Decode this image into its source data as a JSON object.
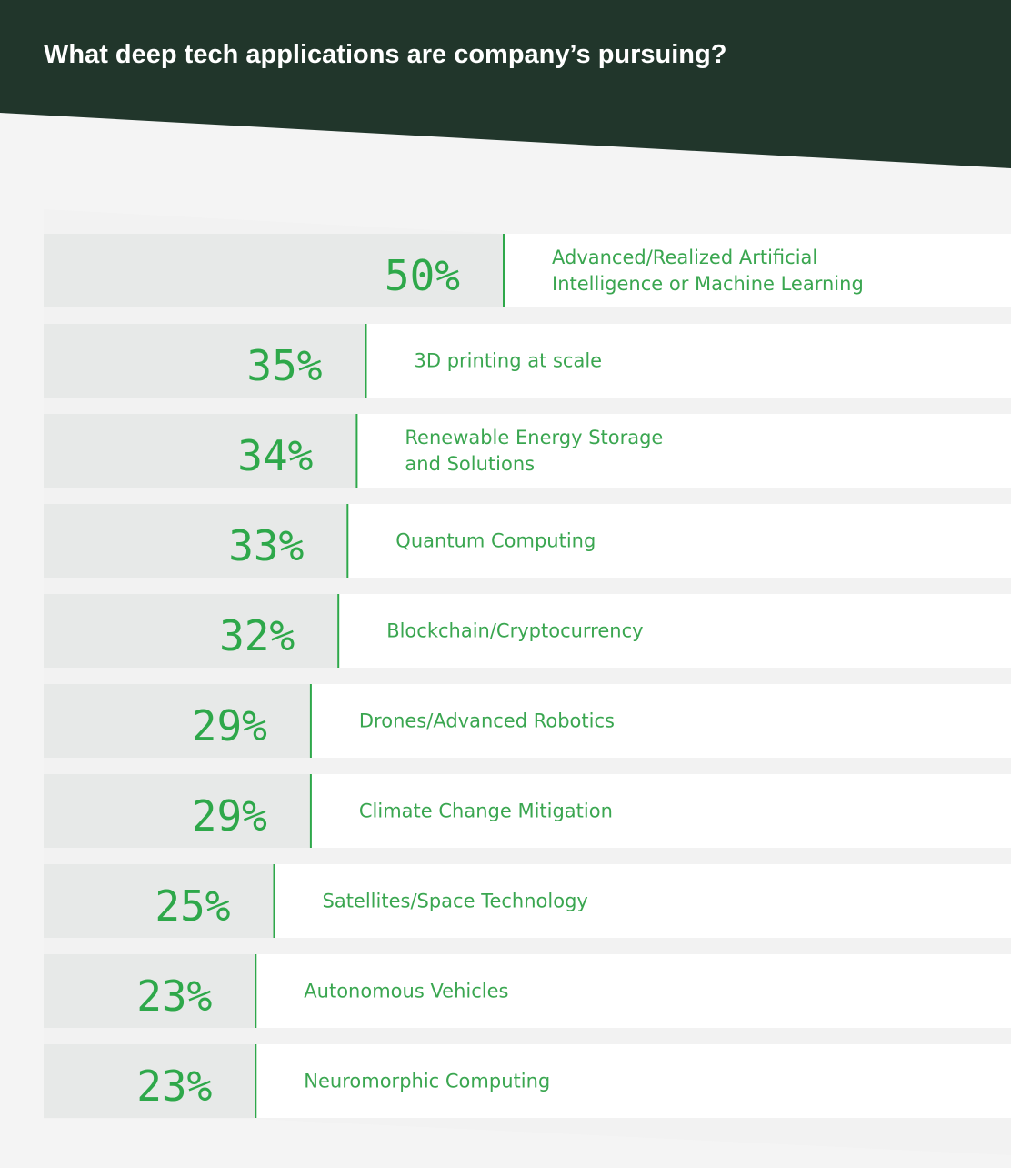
{
  "title": "What deep tech applications are company’s pursuing?",
  "colors": {
    "header": "#21362b",
    "page": "#f4f4f4",
    "bar": "#e7e9e8",
    "row": "#ffffff",
    "accent": "#2ea84a",
    "label": "#3aa650"
  },
  "chart_data": {
    "type": "bar",
    "orientation": "horizontal",
    "title": "What deep tech applications are company’s pursuing?",
    "xlim": [
      0,
      50
    ],
    "categories": [
      "Advanced/Realized Artificial Intelligence or Machine Learning",
      "3D printing at scale",
      "Renewable Energy Storage and Solutions",
      "Quantum Computing",
      "Blockchain/Cryptocurrency",
      "Drones/Advanced Robotics",
      "Climate Change Mitigation",
      "Satellites/Space Technology",
      "Autonomous Vehicles",
      "Neuromorphic Computing"
    ],
    "category_lines": [
      [
        "Advanced/Realized Artificial",
        "Intelligence or Machine Learning"
      ],
      [
        "3D printing at scale"
      ],
      [
        "Renewable Energy Storage",
        "and Solutions"
      ],
      [
        "Quantum Computing"
      ],
      [
        "Blockchain/Cryptocurrency"
      ],
      [
        "Drones/Advanced Robotics"
      ],
      [
        "Climate Change Mitigation"
      ],
      [
        "Satellites/Space Technology"
      ],
      [
        "Autonomous Vehicles"
      ],
      [
        "Neuromorphic Computing"
      ]
    ],
    "values": [
      50,
      35,
      34,
      33,
      32,
      29,
      29,
      25,
      23,
      23
    ],
    "value_suffix": "%"
  }
}
